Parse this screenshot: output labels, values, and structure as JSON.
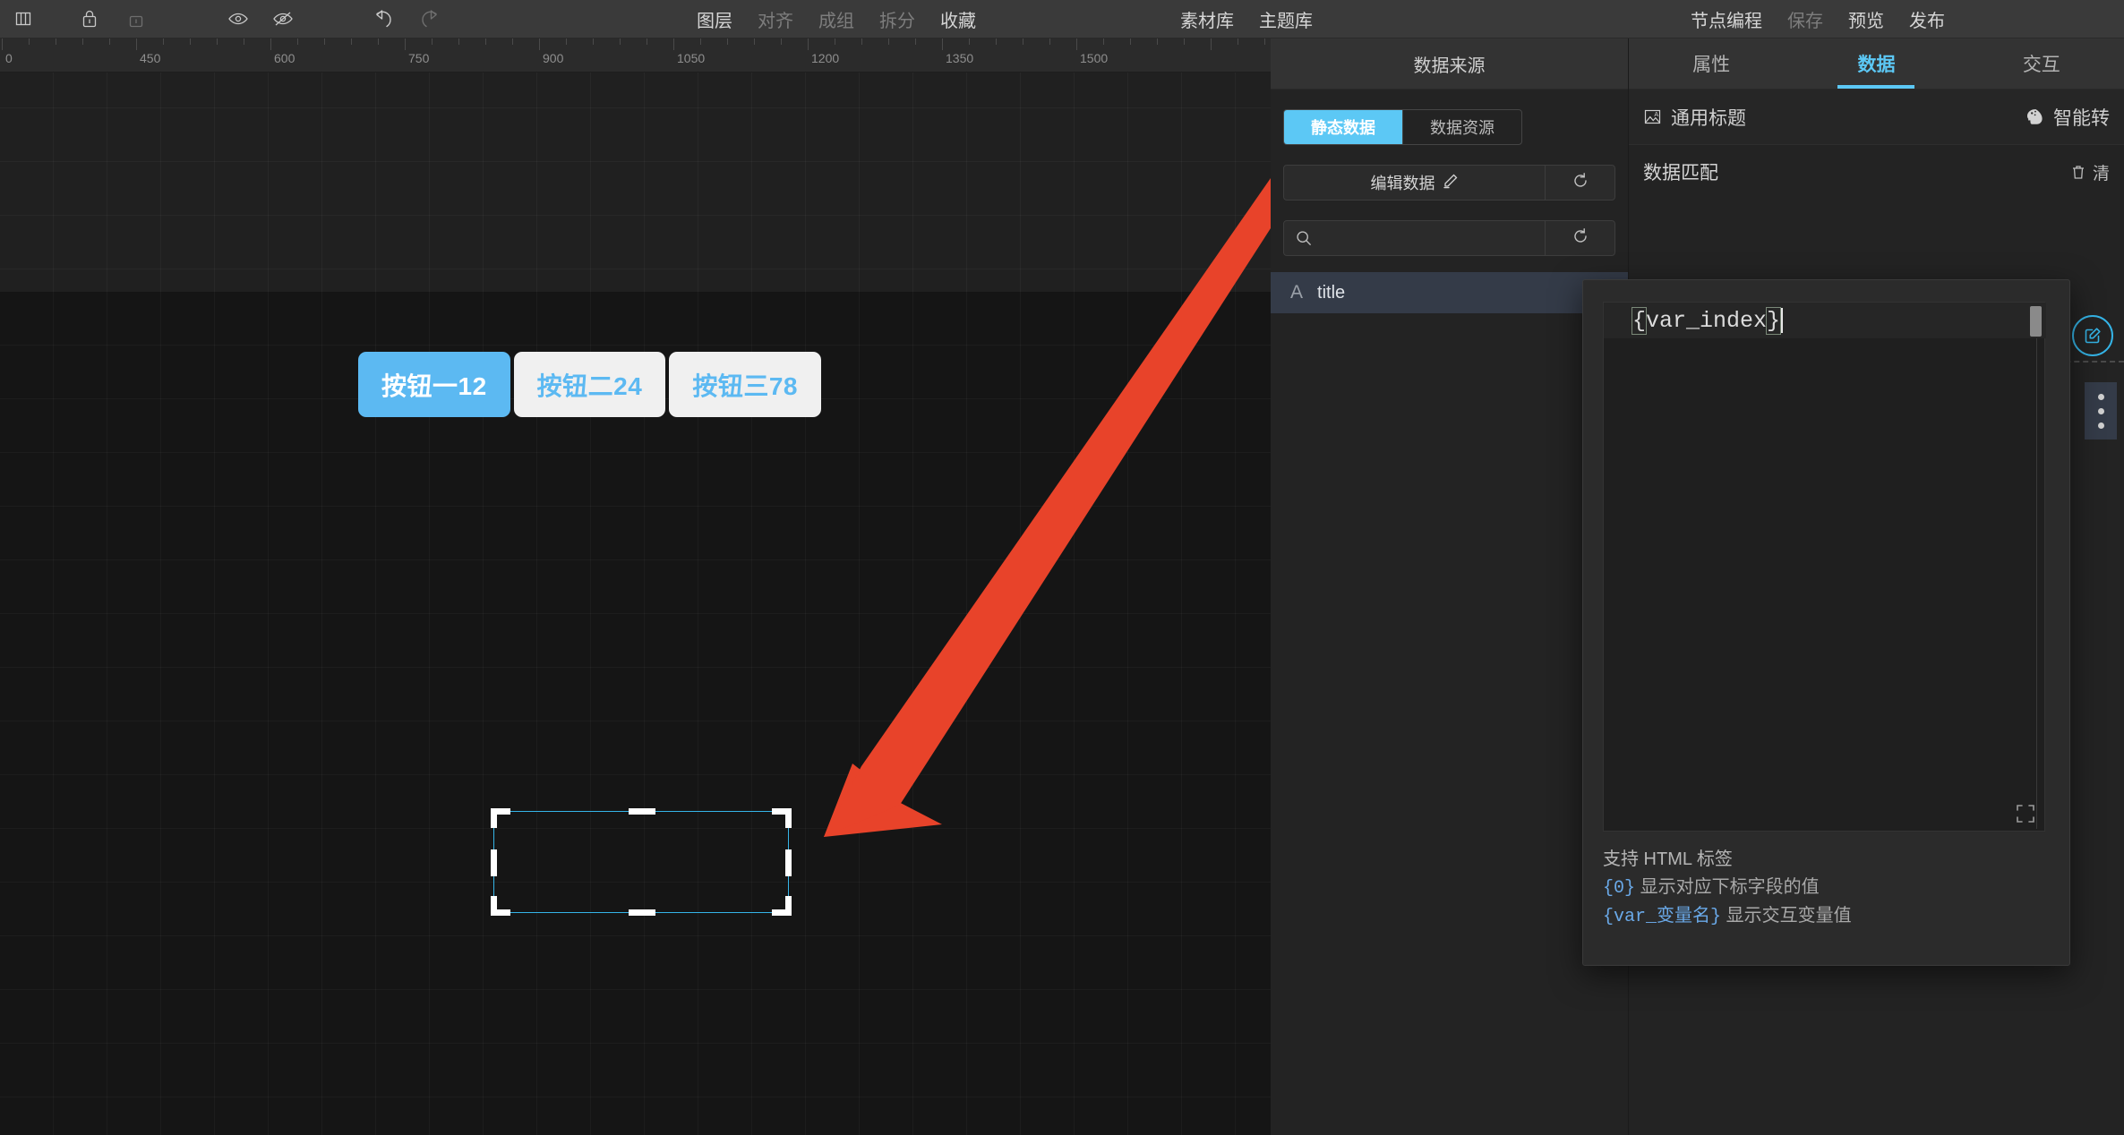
{
  "toolbar": {
    "icons": [
      {
        "name": "panel-columns-icon",
        "dim": false
      },
      {
        "name": "lock-icon",
        "dim": false
      },
      {
        "name": "unlock-icon",
        "dim": true
      },
      {
        "name": "eye-icon",
        "dim": false
      },
      {
        "name": "eye-off-icon",
        "dim": false
      },
      {
        "name": "undo-icon",
        "dim": false
      },
      {
        "name": "redo-icon",
        "dim": true
      }
    ],
    "center_items": [
      {
        "label": "图层",
        "dim": false
      },
      {
        "label": "对齐",
        "dim": true
      },
      {
        "label": "成组",
        "dim": true
      },
      {
        "label": "拆分",
        "dim": true
      },
      {
        "label": "收藏",
        "dim": false
      }
    ],
    "library_items": [
      {
        "label": "素材库",
        "dim": false
      },
      {
        "label": "主题库",
        "dim": false
      }
    ],
    "right_items": [
      {
        "label": "节点编程",
        "dim": false
      },
      {
        "label": "保存",
        "dim": true
      },
      {
        "label": "预览",
        "dim": false
      },
      {
        "label": "发布",
        "dim": false
      }
    ]
  },
  "ruler": {
    "labels": [
      "0",
      "450",
      "600",
      "750",
      "900",
      "1050",
      "1200",
      "1350",
      "1500"
    ],
    "positions": [
      2,
      152,
      302,
      452,
      602,
      752,
      902,
      1052,
      1202
    ]
  },
  "canvas": {
    "buttons": [
      {
        "label": "按钮一12",
        "state": "active"
      },
      {
        "label": "按钮二24",
        "state": "idle"
      },
      {
        "label": "按钮三78",
        "state": "idle"
      }
    ],
    "selection": {
      "name": "empty-text-component"
    },
    "annotation": {
      "name": "red-arrow",
      "color": "#e8432a"
    }
  },
  "data_source": {
    "title": "数据来源",
    "segments": [
      {
        "label": "静态数据",
        "active": true
      },
      {
        "label": "数据资源",
        "active": false
      }
    ],
    "edit_button": "编辑数据",
    "edit_icon": "pencil-icon",
    "reset_icon": "refresh-icon",
    "search_placeholder": "",
    "search_value": "",
    "search_icon": "search-icon",
    "fields": [
      {
        "type": "A",
        "name": "title"
      }
    ]
  },
  "properties": {
    "tabs": [
      {
        "label": "属性",
        "active": false
      },
      {
        "label": "数据",
        "active": true
      },
      {
        "label": "交互",
        "active": false
      }
    ],
    "component_title": "通用标题",
    "component_icon": "image-text-icon",
    "smart_convert": "智能转",
    "smart_convert_icon": "brain-icon",
    "match_label": "数据匹配",
    "clear_label": "清",
    "clear_icon": "trash-icon",
    "edit_icon": "edit-circle-icon",
    "kebab_icon": "more-vertical-icon"
  },
  "code_popup": {
    "value": "{var_index}",
    "value_open": "{",
    "value_body": "var_index",
    "value_close": "}",
    "expand_icon": "fullscreen-icon",
    "help": {
      "line1": "支持 HTML 标签",
      "line2_token": "{0}",
      "line2_text": " 显示对应下标字段的值",
      "line3_token": "{var_变量名}",
      "line3_text": " 显示交互变量值"
    }
  },
  "colors": {
    "accent": "#5cc8f5",
    "accent_deep": "#35b5e8",
    "annotation_red": "#e8432a",
    "panel_bg": "#232323",
    "panel_head": "#333333",
    "canvas_bg": "#151515",
    "selection_row": "#343b48"
  }
}
